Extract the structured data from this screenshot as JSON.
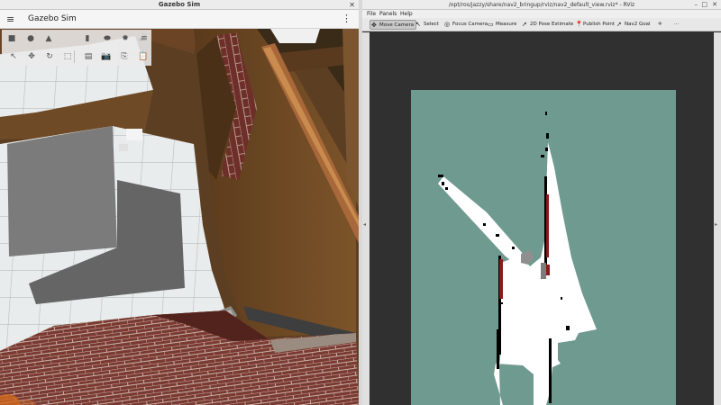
{
  "gazebo": {
    "window_title": "Gazebo Sim",
    "close_glyph": "✕",
    "app_title": "Gazebo Sim",
    "menu_icon": "≡",
    "more_icon": "⋮",
    "toolbar_row1": [
      {
        "name": "box-shape-icon",
        "glyph": "■"
      },
      {
        "name": "sphere-shape-icon",
        "glyph": "●"
      },
      {
        "name": "cone-shape-icon",
        "glyph": "▲"
      },
      {
        "name": "cylinder-shape-icon",
        "glyph": "▮"
      },
      {
        "name": "capsule-shape-icon",
        "glyph": "⬬"
      },
      {
        "name": "sun-light-icon",
        "glyph": "✹"
      },
      {
        "name": "directional-light-icon",
        "glyph": "≡"
      },
      {
        "name": "spot-light-icon",
        "glyph": "☄"
      }
    ],
    "toolbar_row2": [
      {
        "name": "select-mode-icon",
        "glyph": "↖"
      },
      {
        "name": "translate-mode-icon",
        "glyph": "✥"
      },
      {
        "name": "rotate-mode-icon",
        "glyph": "↻"
      },
      {
        "name": "scale-mode-icon",
        "glyph": "⬚"
      },
      {
        "name": "snap-grid-icon",
        "glyph": "▤"
      },
      {
        "name": "screenshot-camera-icon",
        "glyph": "📷"
      },
      {
        "name": "copy-icon",
        "glyph": "⎘"
      },
      {
        "name": "paste-icon",
        "glyph": "📋"
      }
    ]
  },
  "rviz": {
    "window_title": "/opt/ros/jazzy/share/nav2_bringup/rviz/nav2_default_view.rviz* - RViz",
    "window_controls": {
      "minimize": "–",
      "maximize": "□",
      "close": "✕"
    },
    "menu": [
      "File",
      "Panels",
      "Help"
    ],
    "tools": [
      {
        "name": "tool-move-camera",
        "label": "Move Camera",
        "icon": "✥",
        "active": true
      },
      {
        "name": "tool-select",
        "label": "Select",
        "icon": "↖",
        "active": false
      },
      {
        "name": "tool-focus-camera",
        "label": "Focus Camera",
        "icon": "◎",
        "active": false
      },
      {
        "name": "tool-measure",
        "label": "Measure",
        "icon": "▭",
        "active": false
      },
      {
        "name": "tool-2d-pose-estimate",
        "label": "2D Pose Estimate",
        "icon": "➚",
        "active": false
      },
      {
        "name": "tool-publish-point",
        "label": "Publish Point",
        "icon": "📍",
        "active": false
      },
      {
        "name": "tool-nav2-goal",
        "label": "Nav2 Goal",
        "icon": "➚",
        "active": false
      }
    ],
    "extra_tools": {
      "add": "✛",
      "more": "⋯"
    },
    "colors": {
      "unknown_space": "#6f9a8f",
      "free_space": "#ffffff",
      "obstacle": "#000000",
      "inflation": "#8b1a1a",
      "background": "#303030"
    }
  }
}
